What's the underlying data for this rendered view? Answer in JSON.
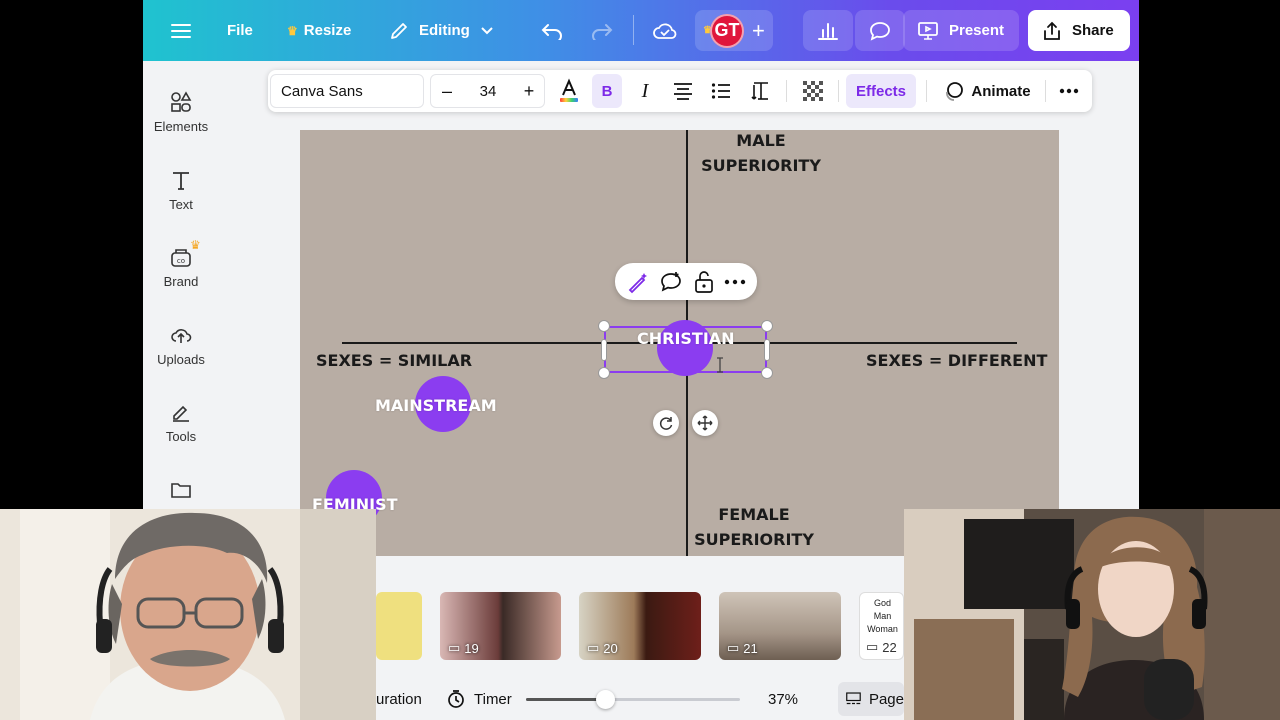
{
  "topbar": {
    "file_label": "File",
    "resize_label": "Resize",
    "editing_label": "Editing",
    "avatar_initials": "GT",
    "present_label": "Present",
    "share_label": "Share"
  },
  "text_toolbar": {
    "font_name": "Canva Sans",
    "font_size": "34",
    "decrease_label": "–",
    "increase_label": "+",
    "bold_label": "B",
    "italic_label": "I",
    "effects_label": "Effects",
    "animate_label": "Animate"
  },
  "sidebar": {
    "items": [
      {
        "label": "Elements",
        "icon": "elements-icon"
      },
      {
        "label": "Text",
        "icon": "text-icon"
      },
      {
        "label": "Brand",
        "icon": "brand-icon"
      },
      {
        "label": "Uploads",
        "icon": "uploads-icon"
      },
      {
        "label": "Tools",
        "icon": "tools-icon"
      },
      {
        "label": "",
        "icon": "projects-icon"
      }
    ]
  },
  "canvas": {
    "top_label_line1": "MALE",
    "top_label_line2": "SUPERIORITY",
    "bottom_label_line1": "FEMALE",
    "bottom_label_line2": "SUPERIORITY",
    "left_label": "SEXES = SIMILAR",
    "right_label": "SEXES = DIFFERENT",
    "points": [
      {
        "label": "CHRISTIAN"
      },
      {
        "label": "MAINSTREAM"
      },
      {
        "label": "FEMINIST"
      }
    ]
  },
  "page_strip": {
    "thumbs": [
      {
        "num": ""
      },
      {
        "num": "19"
      },
      {
        "num": "20"
      },
      {
        "num": "21"
      },
      {
        "num": "22",
        "text": [
          "God",
          "Man",
          "Woman"
        ]
      }
    ]
  },
  "bottom_bar": {
    "duration_label": "uration",
    "timer_label": "Timer",
    "zoom_value": "37%",
    "zoom_level": 0.37,
    "pages_label": "Page"
  },
  "colors": {
    "accent": "#8b3df0",
    "canvas_bg": "#b8ada4",
    "avatar_bg": "#e0163c"
  }
}
